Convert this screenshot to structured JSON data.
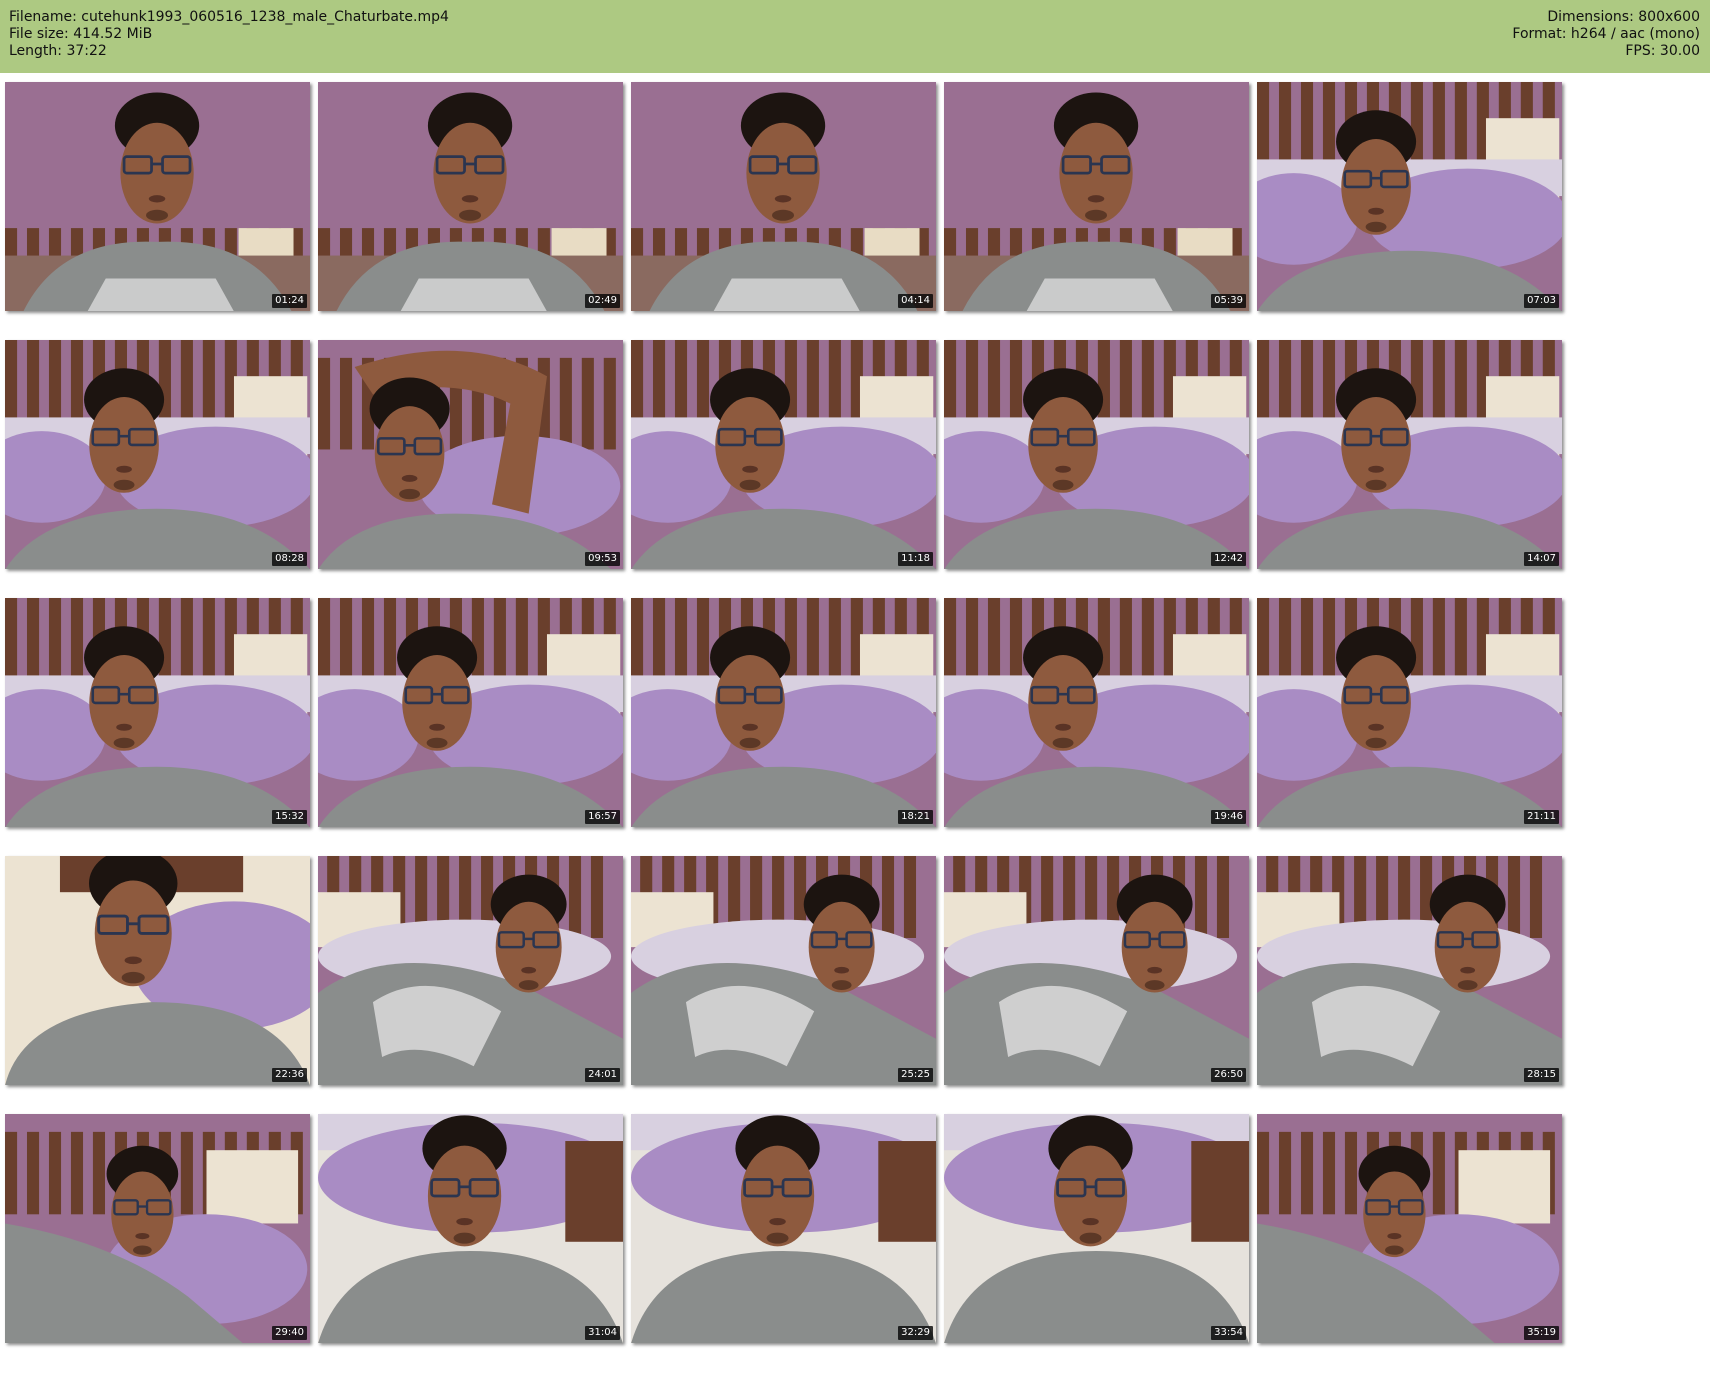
{
  "header": {
    "background": "#adc982",
    "filename": "Filename: cutehunk1993_060516_1238_male_Chaturbate.mp4",
    "filesize": "File size: 414.52 MiB",
    "length": "Length: 37:22",
    "dimensions": "Dimensions: 800x600",
    "format": "Format: h264 / aac (mono)",
    "fps": "FPS: 30.00"
  },
  "thumbnails": [
    {
      "timestamp": "01:24",
      "scene": "wall"
    },
    {
      "timestamp": "02:49",
      "scene": "wall"
    },
    {
      "timestamp": "04:14",
      "scene": "wall"
    },
    {
      "timestamp": "05:39",
      "scene": "wall"
    },
    {
      "timestamp": "07:03",
      "scene": "pillow"
    },
    {
      "timestamp": "08:28",
      "scene": "pillow"
    },
    {
      "timestamp": "09:53",
      "scene": "arm-up"
    },
    {
      "timestamp": "11:18",
      "scene": "pillow"
    },
    {
      "timestamp": "12:42",
      "scene": "pillow"
    },
    {
      "timestamp": "14:07",
      "scene": "pillow"
    },
    {
      "timestamp": "15:32",
      "scene": "pillow"
    },
    {
      "timestamp": "16:57",
      "scene": "pillow"
    },
    {
      "timestamp": "18:21",
      "scene": "pillow"
    },
    {
      "timestamp": "19:46",
      "scene": "pillow"
    },
    {
      "timestamp": "21:11",
      "scene": "pillow"
    },
    {
      "timestamp": "22:36",
      "scene": "close"
    },
    {
      "timestamp": "24:01",
      "scene": "lying"
    },
    {
      "timestamp": "25:25",
      "scene": "lying"
    },
    {
      "timestamp": "26:50",
      "scene": "lying"
    },
    {
      "timestamp": "28:15",
      "scene": "lying"
    },
    {
      "timestamp": "29:40",
      "scene": "tilted"
    },
    {
      "timestamp": "31:04",
      "scene": "pillow-low"
    },
    {
      "timestamp": "32:29",
      "scene": "pillow-low"
    },
    {
      "timestamp": "33:54",
      "scene": "pillow-low"
    },
    {
      "timestamp": "35:19",
      "scene": "tilted"
    }
  ],
  "colors": {
    "wall": "#9a6f92",
    "wood": "#6a3f2c",
    "pillow": "#a98cc4",
    "shirt": "#8a8d8c",
    "skin": "#8e5a3e",
    "hair": "#1c1410",
    "timestamp_bg": "#000000"
  }
}
